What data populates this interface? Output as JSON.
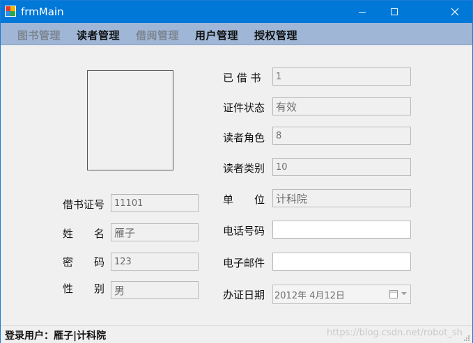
{
  "window": {
    "title": "frmMain"
  },
  "menu": {
    "items": [
      {
        "label": "图书管理",
        "enabled": false
      },
      {
        "label": "读者管理",
        "enabled": true
      },
      {
        "label": "借阅管理",
        "enabled": false
      },
      {
        "label": "用户管理",
        "enabled": true
      },
      {
        "label": "授权管理",
        "enabled": true
      }
    ]
  },
  "left_form": {
    "card_no": {
      "label": "借书证号",
      "value": "11101"
    },
    "name": {
      "label": "姓　　名",
      "value": "雁子"
    },
    "password": {
      "label": "密　　码",
      "value": "123"
    },
    "gender": {
      "label": "性　　别",
      "value": "男"
    }
  },
  "right_form": {
    "borrowed": {
      "label": "已 借 书",
      "value": "1"
    },
    "status": {
      "label": "证件状态",
      "value": "有效"
    },
    "role": {
      "label": "读者角色",
      "value": "8"
    },
    "category": {
      "label": "读者类别",
      "value": "10"
    },
    "unit": {
      "label": "单　　位",
      "value": "计科院"
    },
    "phone": {
      "label": "电话号码",
      "value": ""
    },
    "email": {
      "label": "电子邮件",
      "value": ""
    },
    "issue_date": {
      "label": "办证日期",
      "value": "2012年  4月12日"
    }
  },
  "status": {
    "text": "登录用户：雁子|计科院"
  },
  "watermark": "https://blog.csdn.net/robot_sh",
  "icons": {
    "app": "app-icon",
    "minimize": "minimize-icon",
    "maximize": "maximize-icon",
    "close": "close-icon",
    "calendar": "calendar-icon",
    "dropdown": "chevron-down-icon"
  }
}
